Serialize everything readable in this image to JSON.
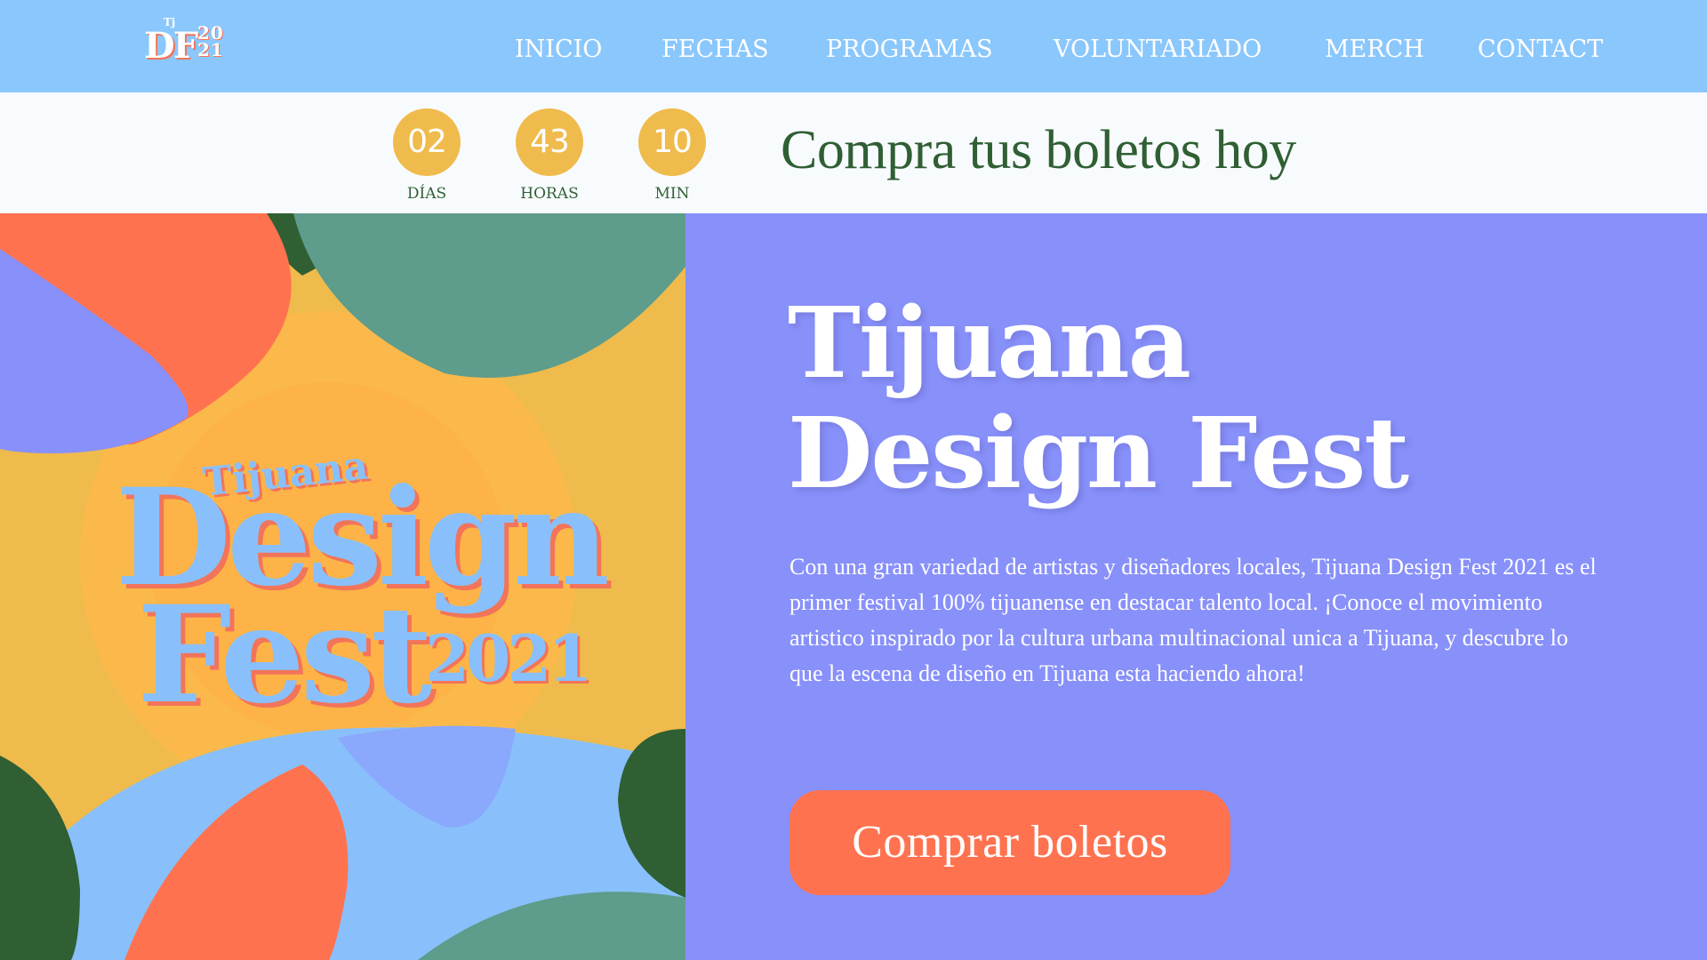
{
  "logo": {
    "small": "Tj",
    "letters": "DF",
    "year_top": "20",
    "year_bottom": "21"
  },
  "nav": {
    "items": [
      {
        "label": "INICIO"
      },
      {
        "label": "FECHAS"
      },
      {
        "label": "PROGRAMAS"
      },
      {
        "label": "VOLUNTARIADO"
      },
      {
        "label": "MERCH"
      },
      {
        "label": "CONTACT"
      }
    ]
  },
  "countdown": {
    "days": {
      "value": "02",
      "label": "DÍAS"
    },
    "hours": {
      "value": "43",
      "label": "HORAS"
    },
    "minutes": {
      "value": "10",
      "label": "MIN"
    },
    "cta_text": "Compra tus boletos hoy"
  },
  "poster": {
    "line1": "Tijuana",
    "line2": "Design",
    "line3": "Fest",
    "year": "2021"
  },
  "hero": {
    "title_line1": "Tijuana",
    "title_line2": "Design Fest",
    "description": "Con una gran variedad de artistas y diseñadores locales, Tijuana Design Fest 2021 es el primer festival 100% tijuanense en destacar talento local. ¡Conoce el movimiento artistico inspirado por la cultura urbana multinacional unica a Tijuana, y descubre lo que la escena de diseño en Tijuana esta haciendo ahora!",
    "button_label": "Comprar boletos"
  },
  "colors": {
    "nav_bg": "#8AC7FC",
    "hero_bg": "#8890FA",
    "accent_orange": "#FF7250",
    "accent_yellow": "#EFBB4C",
    "dark_green": "#2F5F33",
    "teal": "#5E9C8C"
  }
}
